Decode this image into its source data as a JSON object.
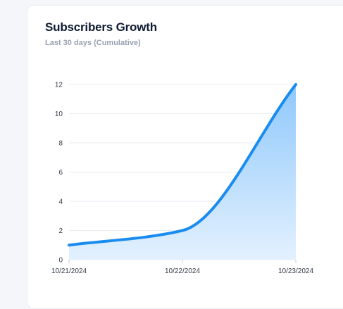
{
  "card": {
    "title": "Subscribers Growth",
    "subtitle": "Last 30 days (Cumulative)"
  },
  "chart_data": {
    "type": "area",
    "title": "Subscribers Growth",
    "subtitle": "Last 30 days (Cumulative)",
    "x": [
      "10/21/2024",
      "10/22/2024",
      "10/23/2024"
    ],
    "y_ticks": [
      "0",
      "2",
      "4",
      "6",
      "8",
      "10",
      "12"
    ],
    "ylim": [
      0,
      12
    ],
    "series": [
      {
        "values": [
          1,
          2,
          12
        ]
      }
    ],
    "grid": true,
    "colors": {
      "line": "#1a8cf0",
      "fill_top": "#8fc8fb",
      "fill_bottom": "#e3f1fe",
      "grid": "#e8ebf0"
    }
  }
}
